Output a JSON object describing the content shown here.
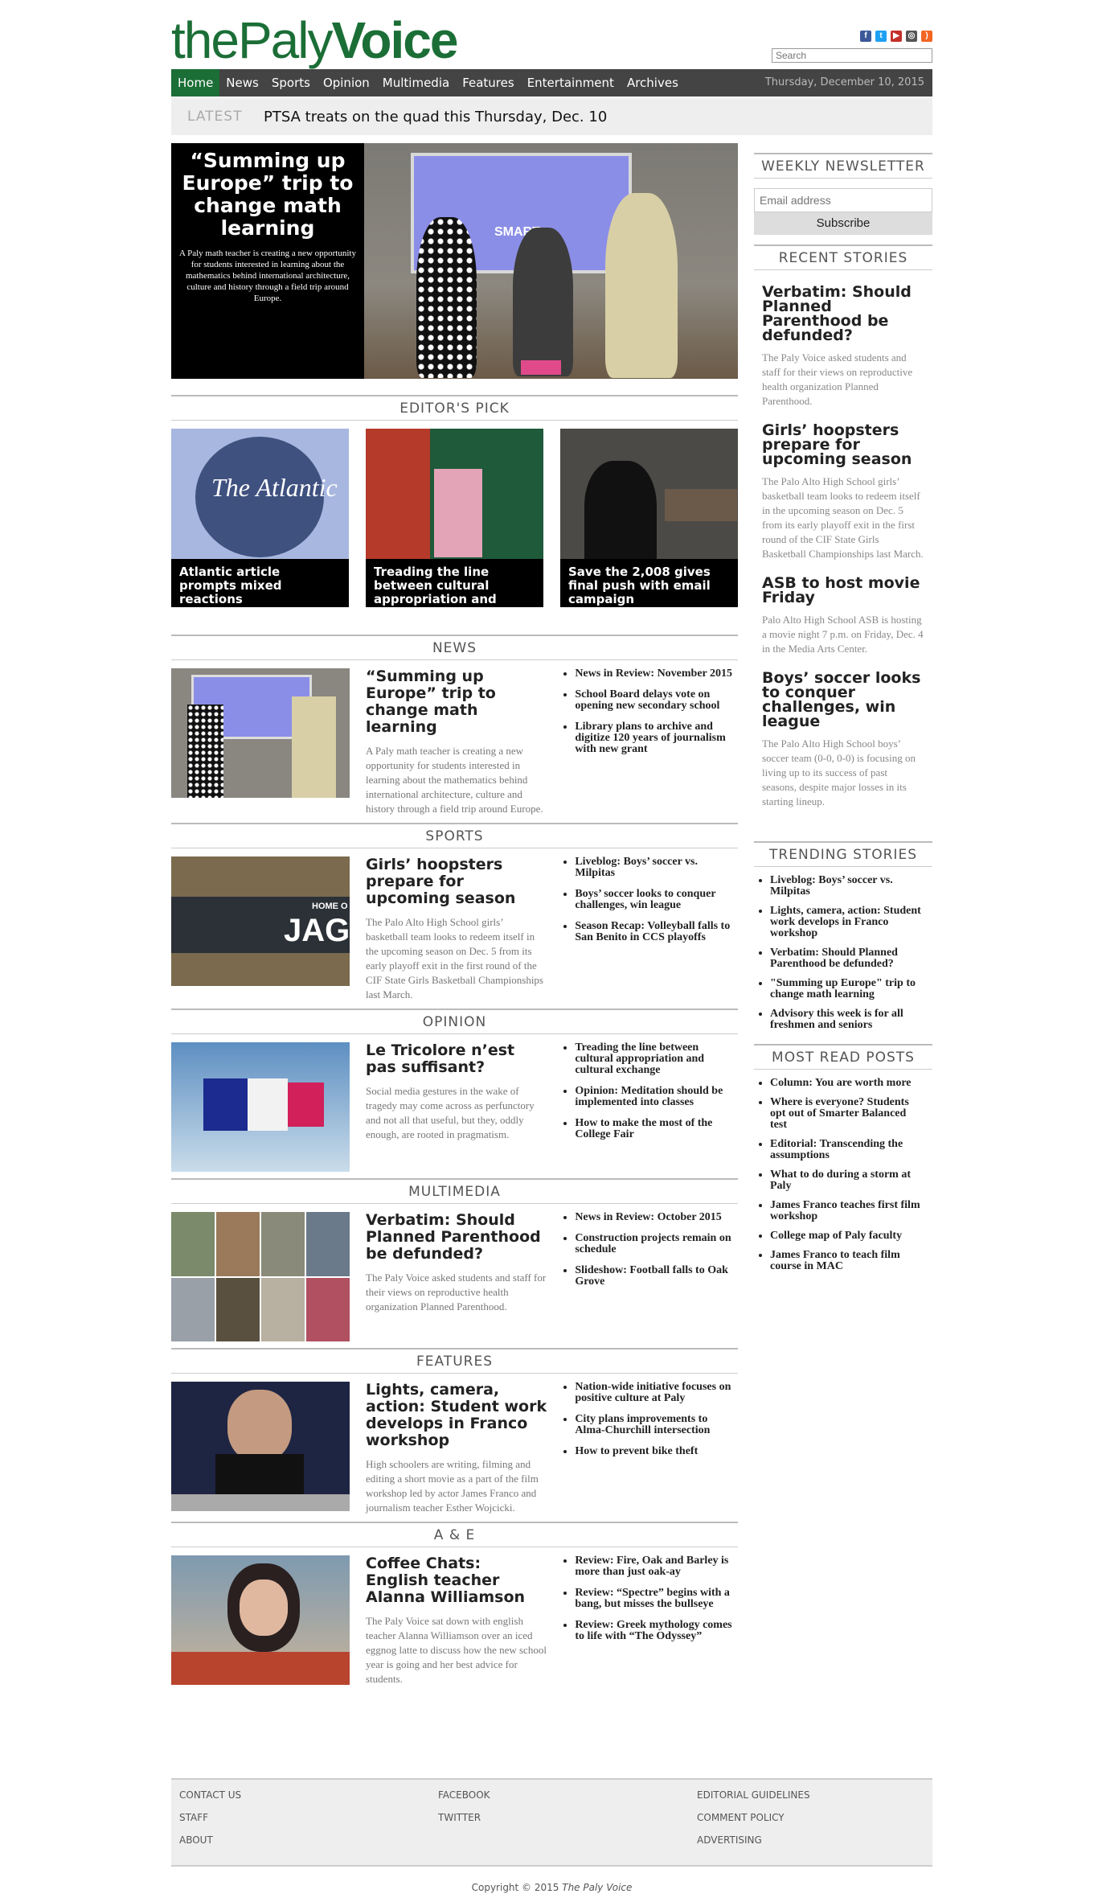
{
  "logo": {
    "part1": "thePaly",
    "part2": "Voice"
  },
  "search": {
    "placeholder": "Search"
  },
  "nav": {
    "items": [
      "Home",
      "News",
      "Sports",
      "Opinion",
      "Multimedia",
      "Features",
      "Entertainment",
      "Archives"
    ],
    "date": "Thursday, December 10, 2015"
  },
  "latest": {
    "tag": "LATEST",
    "text": "PTSA treats on the quad this Thursday, Dec. 10"
  },
  "hero": {
    "title": "“Summing up Europe” trip to change math learning",
    "desc": "A Paly math teacher is creating a new opportunity for students interested in learning about the mathematics behind international architecture, culture and history through a field trip around Europe.",
    "screen_logo": "SMART"
  },
  "editors_pick": {
    "heading": "EDITOR'S PICK",
    "items": [
      "Atlantic article prompts mixed reactions",
      "Treading the line between cultural appropriation and",
      "Save the 2,008 gives final push with email campaign"
    ],
    "atlantic_logo": "The Atlantic"
  },
  "sections": [
    {
      "heading": "NEWS",
      "title": "“Summing up Europe” trip to change math learning",
      "desc": "A Paly math teacher is creating a new opportunity for students interested in learning about the mathematics behind international architecture, culture and history through a field trip around Europe.",
      "links": [
        "News in Review: November 2015",
        "School Board delays vote on opening new secondary school",
        "Library plans to archive and digitize 120 years of journalism with new grant"
      ]
    },
    {
      "heading": "SPORTS",
      "title": "Girls’ hoopsters prepare for upcoming season",
      "desc": "The Palo Alto High School girls’ basketball team looks to redeem itself in the upcoming season on Dec. 5 from its early playoff exit in the first round of the CIF State Girls Basketball Championships last March.",
      "links": [
        "Liveblog: Boys’ soccer vs. Milpitas",
        "Boys’ soccer looks to conquer challenges, win league",
        "Season Recap: Volleyball falls to San Benito in CCS playoffs"
      ],
      "wall_text": "HOME O",
      "wall_big": "JAG"
    },
    {
      "heading": "OPINION",
      "title": "Le Tricolore n’est pas suffisant?",
      "desc": "Social media gestures in the wake of tragedy may come across as perfunctory and not all that useful, but they, oddly enough, are rooted in pragmatism.",
      "links": [
        "Treading the line between cultural appropriation and cultural exchange",
        "Opinion: Meditation should be implemented into classes",
        "How to make the most of the College Fair"
      ]
    },
    {
      "heading": "MULTIMEDIA",
      "title": "Verbatim: Should Planned Parenthood be defunded?",
      "desc": "The Paly Voice asked students and staff for their views on reproductive health organization Planned Parenthood.",
      "links": [
        "News in Review: October 2015",
        "Construction projects remain on schedule",
        "Slideshow: Football falls to Oak Grove"
      ]
    },
    {
      "heading": "FEATURES",
      "title": "Lights, camera, action: Student work develops in Franco workshop",
      "desc": "High schoolers are writing, filming and editing a short movie as a part of the film workshop led by actor James Franco and journalism teacher Esther Wojcicki.",
      "links": [
        "Nation-wide initiative focuses on positive culture at Paly",
        "City plans improvements to Alma-Churchill intersection",
        "How to prevent bike theft"
      ]
    },
    {
      "heading": "A & E",
      "title": "Coffee Chats: English teacher Alanna Williamson",
      "desc": "The Paly Voice sat down with english teacher Alanna Williamson over an iced eggnog latte to discuss how the new school year is going and her best advice for students.",
      "links": [
        "Review: Fire, Oak and Barley is more than just oak-ay",
        "Review: “Spectre” begins with a bang, but misses the bullseye",
        "Review: Greek mythology comes to life with “The Odyssey”"
      ]
    }
  ],
  "sidebar": {
    "newsletter": "WEEKLY NEWSLETTER",
    "email_placeholder": "Email address",
    "subscribe": "Subscribe",
    "recent_heading": "RECENT STORIES",
    "recent": [
      {
        "title": "Verbatim: Should Planned Parenthood be defunded?",
        "desc": "The Paly Voice asked students and staff for their views on reproductive health organization Planned Parenthood."
      },
      {
        "title": "Girls’ hoopsters prepare for upcoming season",
        "desc": "The Palo Alto High School girls’ basketball team looks to redeem itself in the upcoming season on Dec. 5 from its early playoff exit in the first round of the CIF State Girls Basketball Championships last March."
      },
      {
        "title": "ASB to host movie Friday",
        "desc": "Palo Alto High School ASB is hosting a movie night 7 p.m. on Friday, Dec. 4 in the Media Arts Center."
      },
      {
        "title": "Boys’ soccer looks to conquer challenges, win league",
        "desc": "The Palo Alto High School boys’ soccer team (0-0, 0-0) is focusing on living up to its success of past seasons, despite major losses in its starting lineup."
      }
    ],
    "trending_heading": "TRENDING STORIES",
    "trending": [
      "Liveblog: Boys’ soccer vs. Milpitas",
      "Lights, camera, action: Student work develops in Franco workshop",
      "Verbatim: Should Planned Parenthood be defunded?",
      "\"Summing up Europe\" trip to change math learning",
      "Advisory this week is for all freshmen and seniors"
    ],
    "most_heading": "MOST READ POSTS",
    "most": [
      "Column: You are worth more",
      "Where is everyone? Students opt out of Smarter Balanced test",
      "Editorial: Transcending the assumptions",
      "What to do during a storm at Paly",
      "James Franco teaches first film workshop",
      "College map of Paly faculty",
      "James Franco to teach film course in MAC"
    ]
  },
  "footer": {
    "col1": [
      "CONTACT US",
      "STAFF",
      "ABOUT"
    ],
    "col2": [
      "FACEBOOK",
      "TWITTER"
    ],
    "col3": [
      "EDITORIAL GUIDELINES",
      "COMMENT POLICY",
      "ADVERTISING"
    ],
    "copyright": "Copyright © 2015",
    "copyright_name": "The Paly Voice"
  },
  "colors": {
    "brand": "#1b6e36",
    "nav": "#444444"
  }
}
